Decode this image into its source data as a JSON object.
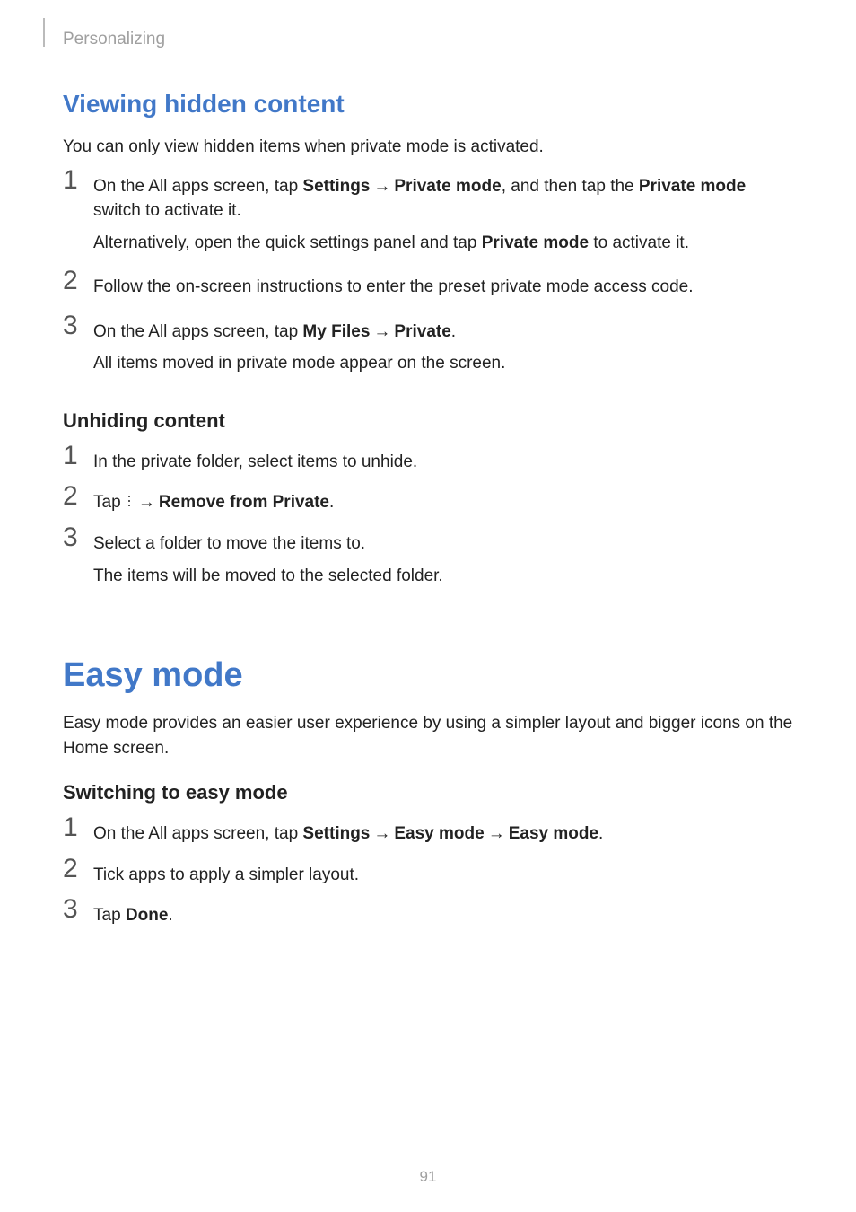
{
  "breadcrumb": "Personalizing",
  "page_number": "91",
  "viewing": {
    "title": "Viewing hidden content",
    "intro": "You can only view hidden items when private mode is activated.",
    "steps": [
      {
        "num": "1",
        "line1_pre": "On the All apps screen, tap ",
        "line1_b1": "Settings",
        "line1_b2": "Private mode",
        "line1_mid": ", and then tap the ",
        "line1_b3": "Private mode",
        "line1_post": " switch to activate it.",
        "sub_pre": "Alternatively, open the quick settings panel and tap ",
        "sub_b": "Private mode",
        "sub_post": " to activate it."
      },
      {
        "num": "2",
        "line": "Follow the on-screen instructions to enter the preset private mode access code."
      },
      {
        "num": "3",
        "line_pre": "On the All apps screen, tap ",
        "line_b1": "My Files",
        "line_b2": "Private",
        "sub": "All items moved in private mode appear on the screen."
      }
    ]
  },
  "unhiding": {
    "title": "Unhiding content",
    "steps": [
      {
        "num": "1",
        "line": "In the private folder, select items to unhide."
      },
      {
        "num": "2",
        "line_pre": "Tap ",
        "line_b": "Remove from Private",
        "line_post": "."
      },
      {
        "num": "3",
        "line": "Select a folder to move the items to.",
        "sub": "The items will be moved to the selected folder."
      }
    ]
  },
  "easy": {
    "title": "Easy mode",
    "intro": "Easy mode provides an easier user experience by using a simpler layout and bigger icons on the Home screen.",
    "sub_title": "Switching to easy mode",
    "steps": [
      {
        "num": "1",
        "line_pre": "On the All apps screen, tap ",
        "line_b1": "Settings",
        "line_b2": "Easy mode",
        "line_b3": "Easy mode",
        "line_post": "."
      },
      {
        "num": "2",
        "line": "Tick apps to apply a simpler layout."
      },
      {
        "num": "3",
        "line_pre": "Tap ",
        "line_b": "Done",
        "line_post": "."
      }
    ]
  }
}
